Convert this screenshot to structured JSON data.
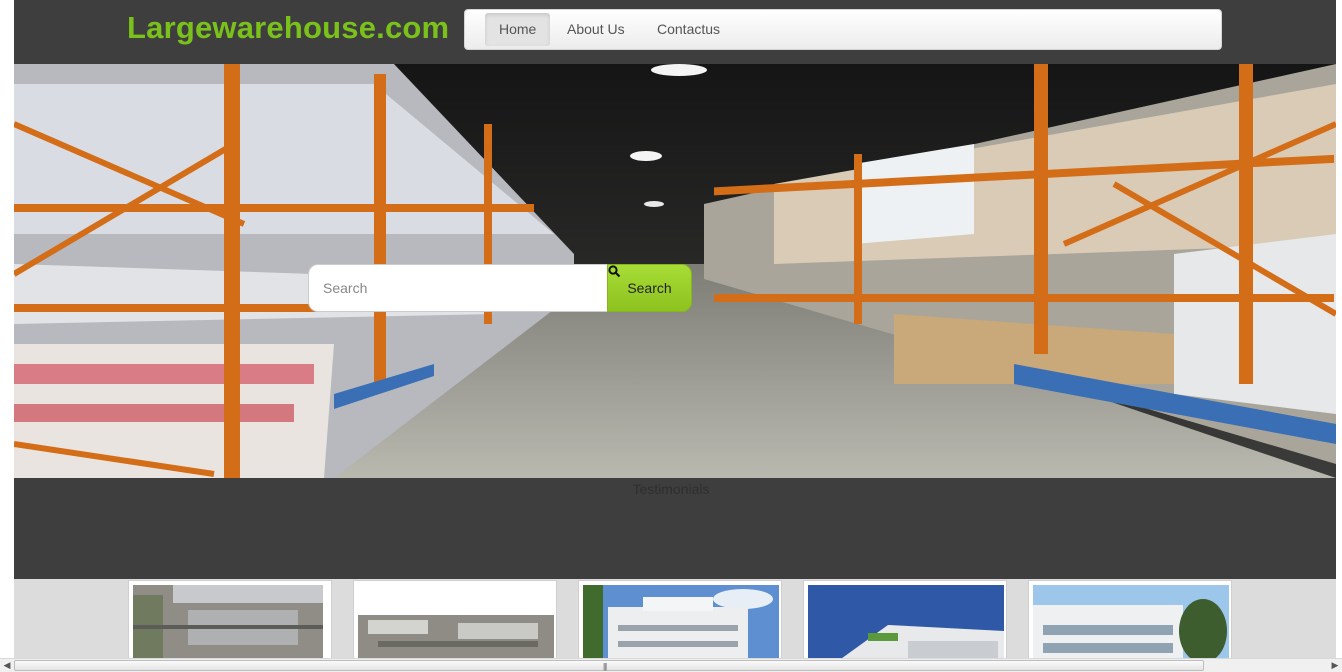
{
  "header": {
    "logo": "Largewarehouse.com",
    "nav": [
      {
        "label": "Home",
        "active": true
      },
      {
        "label": "About Us",
        "active": false
      },
      {
        "label": "Contactus",
        "active": false
      }
    ]
  },
  "hero": {
    "search_placeholder": "Search",
    "search_button": "Search",
    "search_icon": "magnifier-icon",
    "image": "warehouse-aisle-photo"
  },
  "sections": {
    "testimonials_label": "Testimonials"
  },
  "gallery": {
    "items": [
      "aerial-industrial-photo",
      "industrial-park-photo",
      "office-building-photo",
      "glass-office-building-photo",
      "white-office-building-photo"
    ]
  },
  "colors": {
    "brand_green": "#7ac21b",
    "search_button": "#9ad12a",
    "page_background": "#3e3e3e"
  }
}
